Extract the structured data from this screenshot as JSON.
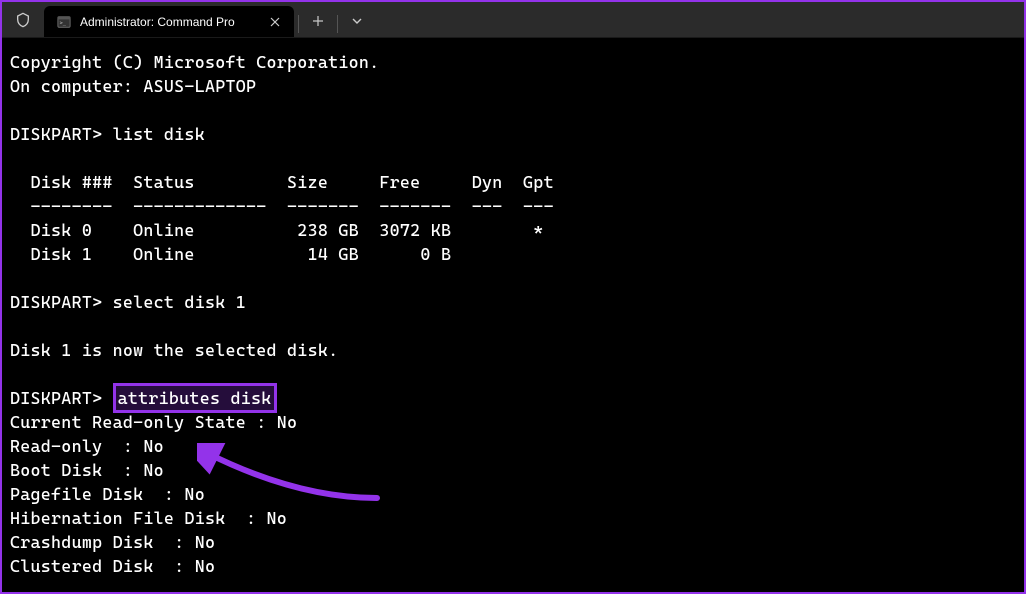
{
  "tab": {
    "title": "Administrator: Command Pro"
  },
  "terminal": {
    "copyright": "Copyright (C) Microsoft Corporation.",
    "computer": "On computer: ASUS-LAPTOP",
    "prompt1": "DISKPART> ",
    "cmd1": "list disk",
    "table_header": "  Disk ###  Status         Size     Free     Dyn  Gpt",
    "table_divider": "  --------  -------------  -------  -------  ---  ---",
    "table_row1": "  Disk 0    Online          238 GB  3072 KB        *",
    "table_row2": "  Disk 1    Online           14 GB      0 B",
    "prompt2": "DISKPART> ",
    "cmd2": "select disk 1",
    "select_result": "Disk 1 is now the selected disk.",
    "prompt3": "DISKPART> ",
    "cmd3": "attributes disk",
    "attr1": "Current Read-only State : No",
    "attr2": "Read-only  : No",
    "attr3": "Boot Disk  : No",
    "attr4": "Pagefile Disk  : No",
    "attr5": "Hibernation File Disk  : No",
    "attr6": "Crashdump Disk  : No",
    "attr7": "Clustered Disk  : No"
  }
}
